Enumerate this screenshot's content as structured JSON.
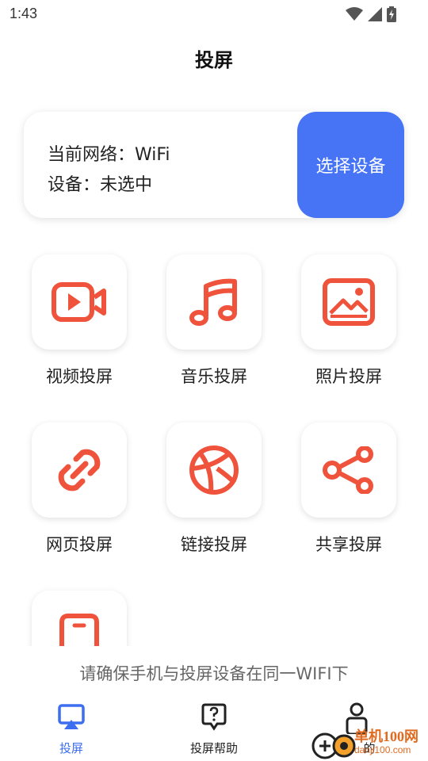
{
  "status_bar": {
    "time": "1:43",
    "icons": [
      "wifi-icon",
      "signal-icon",
      "battery-charging-icon"
    ]
  },
  "header": {
    "title": "投屏"
  },
  "network_card": {
    "network_line": "当前网络：WiFi",
    "device_line": "设备：未选中",
    "select_button": "选择设备"
  },
  "features": [
    {
      "label": "视频投屏",
      "icon": "video-camera-icon"
    },
    {
      "label": "音乐投屏",
      "icon": "music-note-icon"
    },
    {
      "label": "照片投屏",
      "icon": "photo-icon"
    },
    {
      "label": "网页投屏",
      "icon": "link-icon"
    },
    {
      "label": "链接投屏",
      "icon": "basketball-icon"
    },
    {
      "label": "共享投屏",
      "icon": "share-icon"
    },
    {
      "label": "",
      "icon": "device-icon"
    }
  ],
  "hint": "请确保手机与投屏设备在同一WIFI下",
  "bottom_nav": {
    "items": [
      {
        "label": "投屏",
        "icon": "cast-screen-icon",
        "active": true
      },
      {
        "label": "投屏帮助",
        "icon": "help-bubble-icon",
        "active": false
      },
      {
        "label": "的",
        "icon": "person-icon",
        "active": false
      }
    ]
  },
  "watermark": {
    "line1": "单机100网",
    "line2": "danji100.com"
  },
  "colors": {
    "accent": "#4674f5",
    "icon": "#f0533c",
    "nav_active": "#3d6ef0"
  }
}
